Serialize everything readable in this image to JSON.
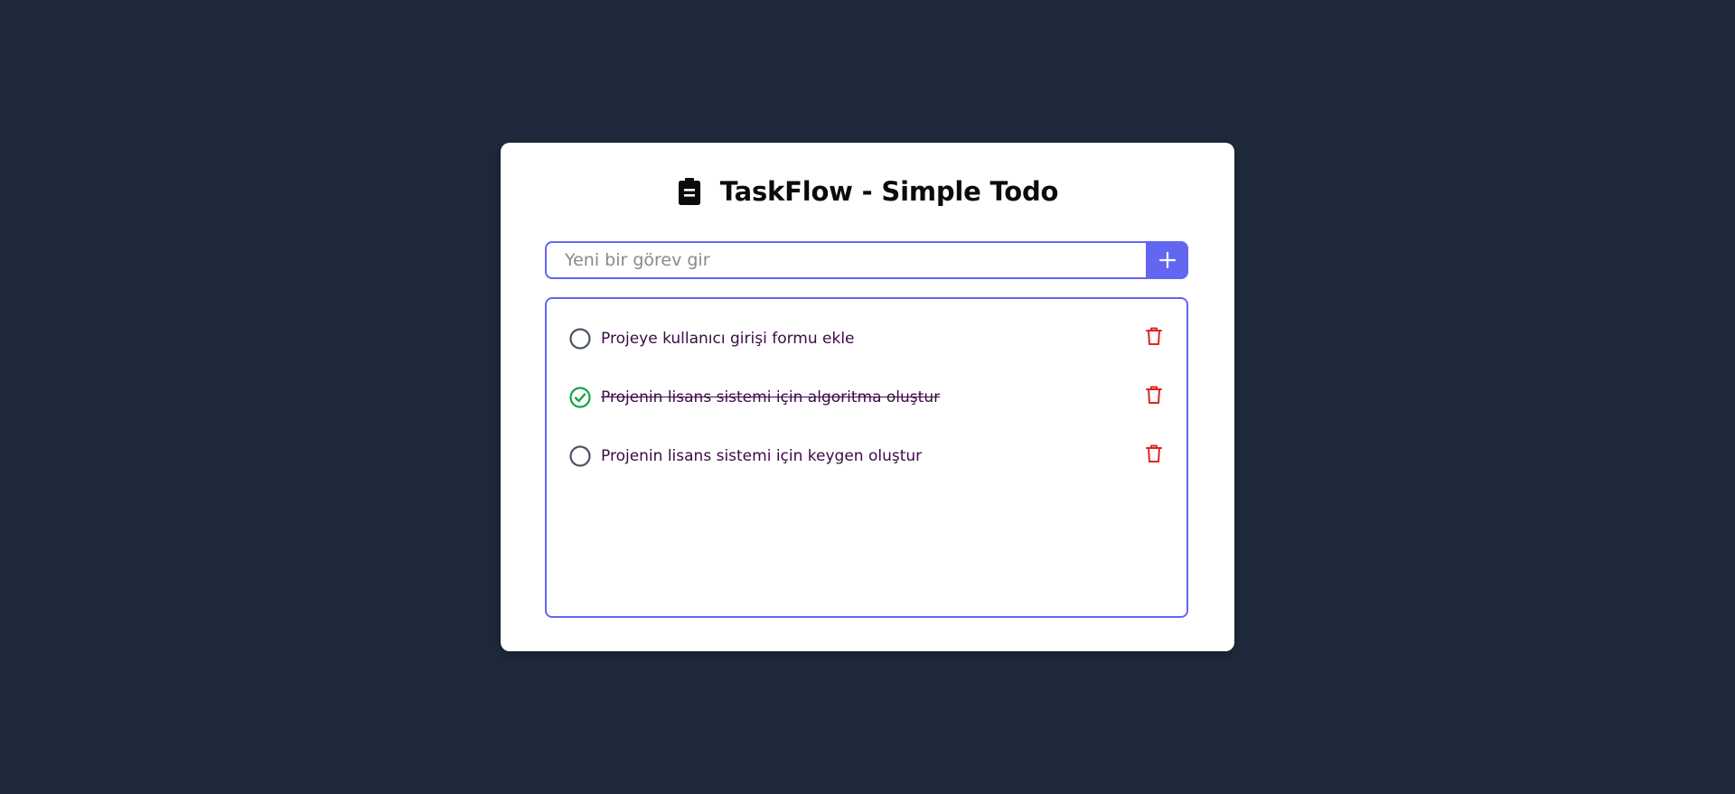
{
  "app": {
    "title": "TaskFlow - Simple Todo",
    "background_color": "#1e293b",
    "accent_color": "#6366f1",
    "title_icon": "clipboard-icon"
  },
  "add_task": {
    "placeholder": "Yeni bir görev gir",
    "value": "",
    "button_icon": "plus-icon"
  },
  "tasks": [
    {
      "text": "Projeye kullanıcı girişi formu ekle",
      "completed": false,
      "status_icon": "circle-icon",
      "delete_icon": "trash-icon"
    },
    {
      "text": "Projenin lisans sistemi için algoritma oluştur",
      "completed": true,
      "status_icon": "check-circle-icon",
      "delete_icon": "trash-icon"
    },
    {
      "text": "Projenin lisans sistemi için keygen oluştur",
      "completed": false,
      "status_icon": "circle-icon",
      "delete_icon": "trash-icon"
    }
  ],
  "colors": {
    "completed": "#16a34a",
    "pending": "#4b5563",
    "delete": "#dc2626",
    "task_text": "#3b0a45"
  }
}
